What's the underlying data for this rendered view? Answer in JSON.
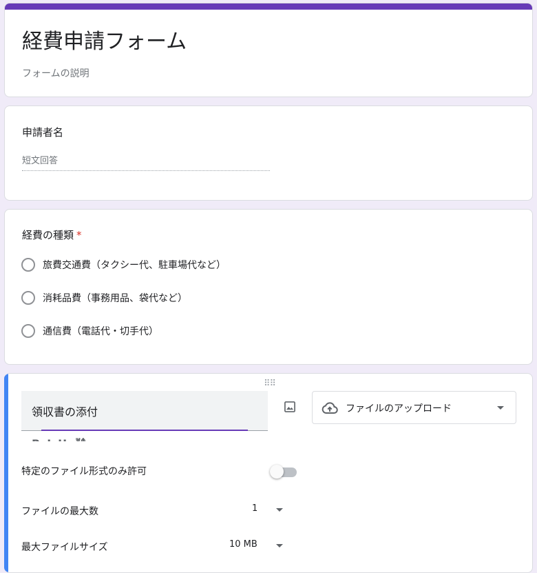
{
  "form": {
    "title": "経費申請フォーム",
    "description": "フォームの説明"
  },
  "accent_color": "#673ab7",
  "active_indicator_color": "#4285f4",
  "questions": [
    {
      "title": "申請者名",
      "answer_placeholder": "短文回答"
    },
    {
      "title": "経費の種類",
      "required_mark": "*",
      "options": [
        "旅費交通費（タクシー代、駐車場代など）",
        "消耗品費（事務用品、袋代など）",
        "通信費（電話代・切手代）"
      ]
    },
    {
      "title": "領収書の添付",
      "type_label": "ファイルのアップロード",
      "type_icon": "cloud-upload-icon",
      "settings": {
        "specific_types_label": "特定のファイル形式のみ許可",
        "specific_types_enabled": false,
        "max_files_label": "ファイルの最大数",
        "max_files_value": "1",
        "max_size_label": "最大ファイルサイズ",
        "max_size_value": "10 MB"
      }
    }
  ]
}
